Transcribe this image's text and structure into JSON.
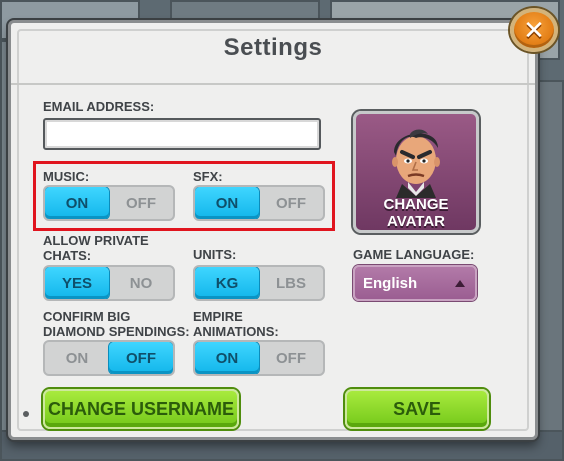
{
  "window": {
    "title": "Settings"
  },
  "email": {
    "label": "EMAIL ADDRESS:",
    "value": "",
    "placeholder": ""
  },
  "music": {
    "label": "MUSIC:",
    "on": "ON",
    "off": "OFF",
    "selected": "on"
  },
  "sfx": {
    "label": "SFX:",
    "on": "ON",
    "off": "OFF",
    "selected": "on"
  },
  "private_chats": {
    "label_line1": "ALLOW PRIVATE",
    "label_line2": "CHATS:",
    "yes": "YES",
    "no": "NO",
    "selected": "yes"
  },
  "units": {
    "label": "UNITS:",
    "kg": "KG",
    "lbs": "LBS",
    "selected": "kg"
  },
  "diamond": {
    "label_line1": "CONFIRM BIG",
    "label_line2": "DIAMOND SPENDINGS:",
    "on": "ON",
    "off": "OFF",
    "selected": "off"
  },
  "animations": {
    "label_line1": "EMPIRE",
    "label_line2": "ANIMATIONS:",
    "on": "ON",
    "off": "OFF",
    "selected": "on"
  },
  "avatar": {
    "label_line1": "CHANGE",
    "label_line2": "AVATAR"
  },
  "language": {
    "label": "GAME LANGUAGE:",
    "value": "English"
  },
  "buttons": {
    "change_username": "CHANGE USERNAME",
    "save": "SAVE"
  },
  "icons": {
    "close": "close-icon",
    "avatar": "avatar-portrait-icon",
    "dropdown": "caret-up-icon"
  },
  "colors": {
    "toggle_active": "#12b6ea",
    "button_green": "#74c81a",
    "avatar_bg": "#6f3862",
    "close": "#e07a12",
    "highlight": "#e0141e"
  }
}
